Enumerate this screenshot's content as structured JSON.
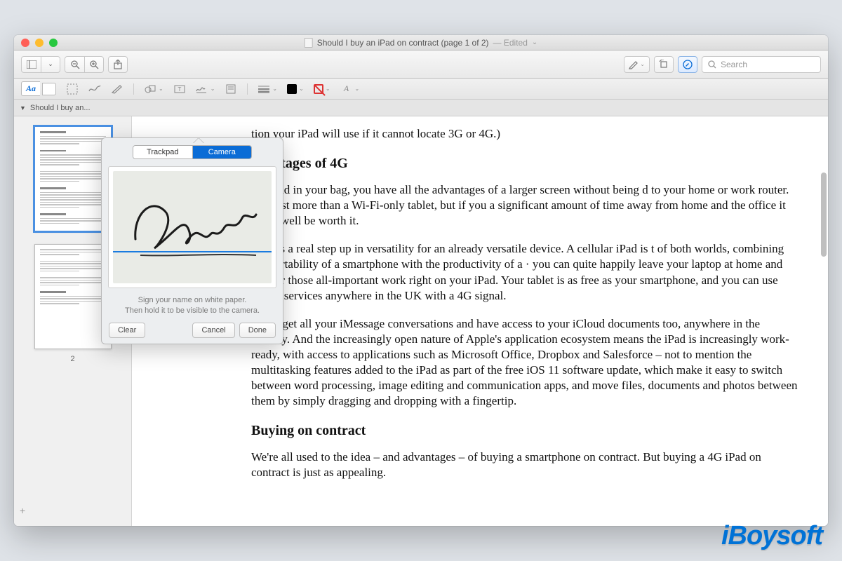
{
  "window": {
    "title": "Should I buy an iPad on contract (page 1 of 2)",
    "edited_suffix": "— Edited"
  },
  "toolbar": {
    "search_placeholder": "Search"
  },
  "markup": {
    "text_tool_label": "Aa"
  },
  "tab": {
    "label": "Should I buy an..."
  },
  "sidebar": {
    "page2_label": "2",
    "add_label": "+"
  },
  "popover": {
    "tabs": {
      "trackpad": "Trackpad",
      "camera": "Camera"
    },
    "hint_line1": "Sign your name on white paper.",
    "hint_line2": "Then hold it to be visible to the camera.",
    "buttons": {
      "clear": "Clear",
      "cancel": "Cancel",
      "done": "Done"
    }
  },
  "document": {
    "p_top": "tion your iPad will use if it cannot locate 3G or 4G.)",
    "h_adv": "dvantages of 4G",
    "p1": "4G iPad in your bag, you have all the advantages of a larger screen without being d to your home or work router. It'll cost more than a Wi-Fi-only tablet, but if you a significant amount of time away from home and the office it could well be worth it.",
    "p2": "e 4G is a real step up in versatility for an already versatile device. A cellular iPad is t of both worlds, combining the portability of a smartphone with the productivity of a · you can quite happily leave your laptop at home and answer those all-important work right on your iPad. Your tablet is as free as your smartphone, and you can use online services anywhere in the UK with a 4G signal.",
    "p3": "You'll get all your iMessage conversations and have access to your iCloud documents too, anywhere in the country. And the increasingly open nature of Apple's application ecosystem means the iPad is increasingly work-ready, with access to applications such as Microsoft Office, Dropbox and Salesforce – not to mention the multitasking features added to the iPad as part of the free iOS 11 software update, which make it easy to switch between word processing, image editing and communication apps, and move files, documents and photos between them by simply dragging and dropping with a fingertip.",
    "h_buy": "Buying on contract",
    "p4": "We're all used to the idea – and advantages – of buying a smartphone on contract. But buying a 4G iPad on contract is just as appealing."
  },
  "watermark": "iBoysoft"
}
